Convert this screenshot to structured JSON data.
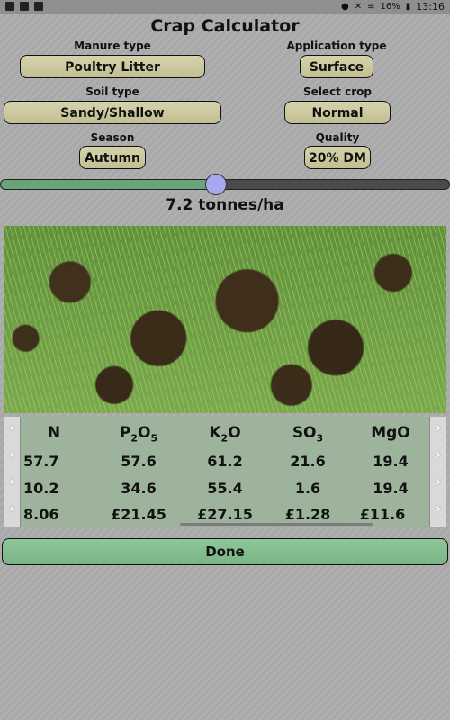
{
  "status_bar": {
    "battery": "16%",
    "time": "13:16"
  },
  "title": "Crap Calculator",
  "fields": {
    "manure_type": {
      "label": "Manure type",
      "value": "Poultry Litter"
    },
    "application_type": {
      "label": "Application type",
      "value": "Surface"
    },
    "soil_type": {
      "label": "Soil type",
      "value": "Sandy/Shallow"
    },
    "select_crop": {
      "label": "Select crop",
      "value": "Normal"
    },
    "season": {
      "label": "Season",
      "value": "Autumn"
    },
    "quality": {
      "label": "Quality",
      "value": "20% DM"
    }
  },
  "slider": {
    "fraction": 0.48
  },
  "rate_text": "7.2 tonnes/ha",
  "table": {
    "headers": [
      "N",
      "P2O5",
      "K2O",
      "SO3",
      "MgO"
    ],
    "rows": [
      [
        "57.7",
        "57.6",
        "61.2",
        "21.6",
        "19.4"
      ],
      [
        "10.2",
        "34.6",
        "55.4",
        "1.6",
        "19.4"
      ],
      [
        "8.06",
        "£21.45",
        "£27.15",
        "£1.28",
        "£11.6"
      ]
    ]
  },
  "done_label": "Done",
  "colors": {
    "pill_bg": "#cfcba3",
    "slider_fill": "#6aa37a",
    "slider_thumb": "#a7a9ee",
    "table_bg": "#9db39b",
    "done_bg": "#86be92"
  }
}
